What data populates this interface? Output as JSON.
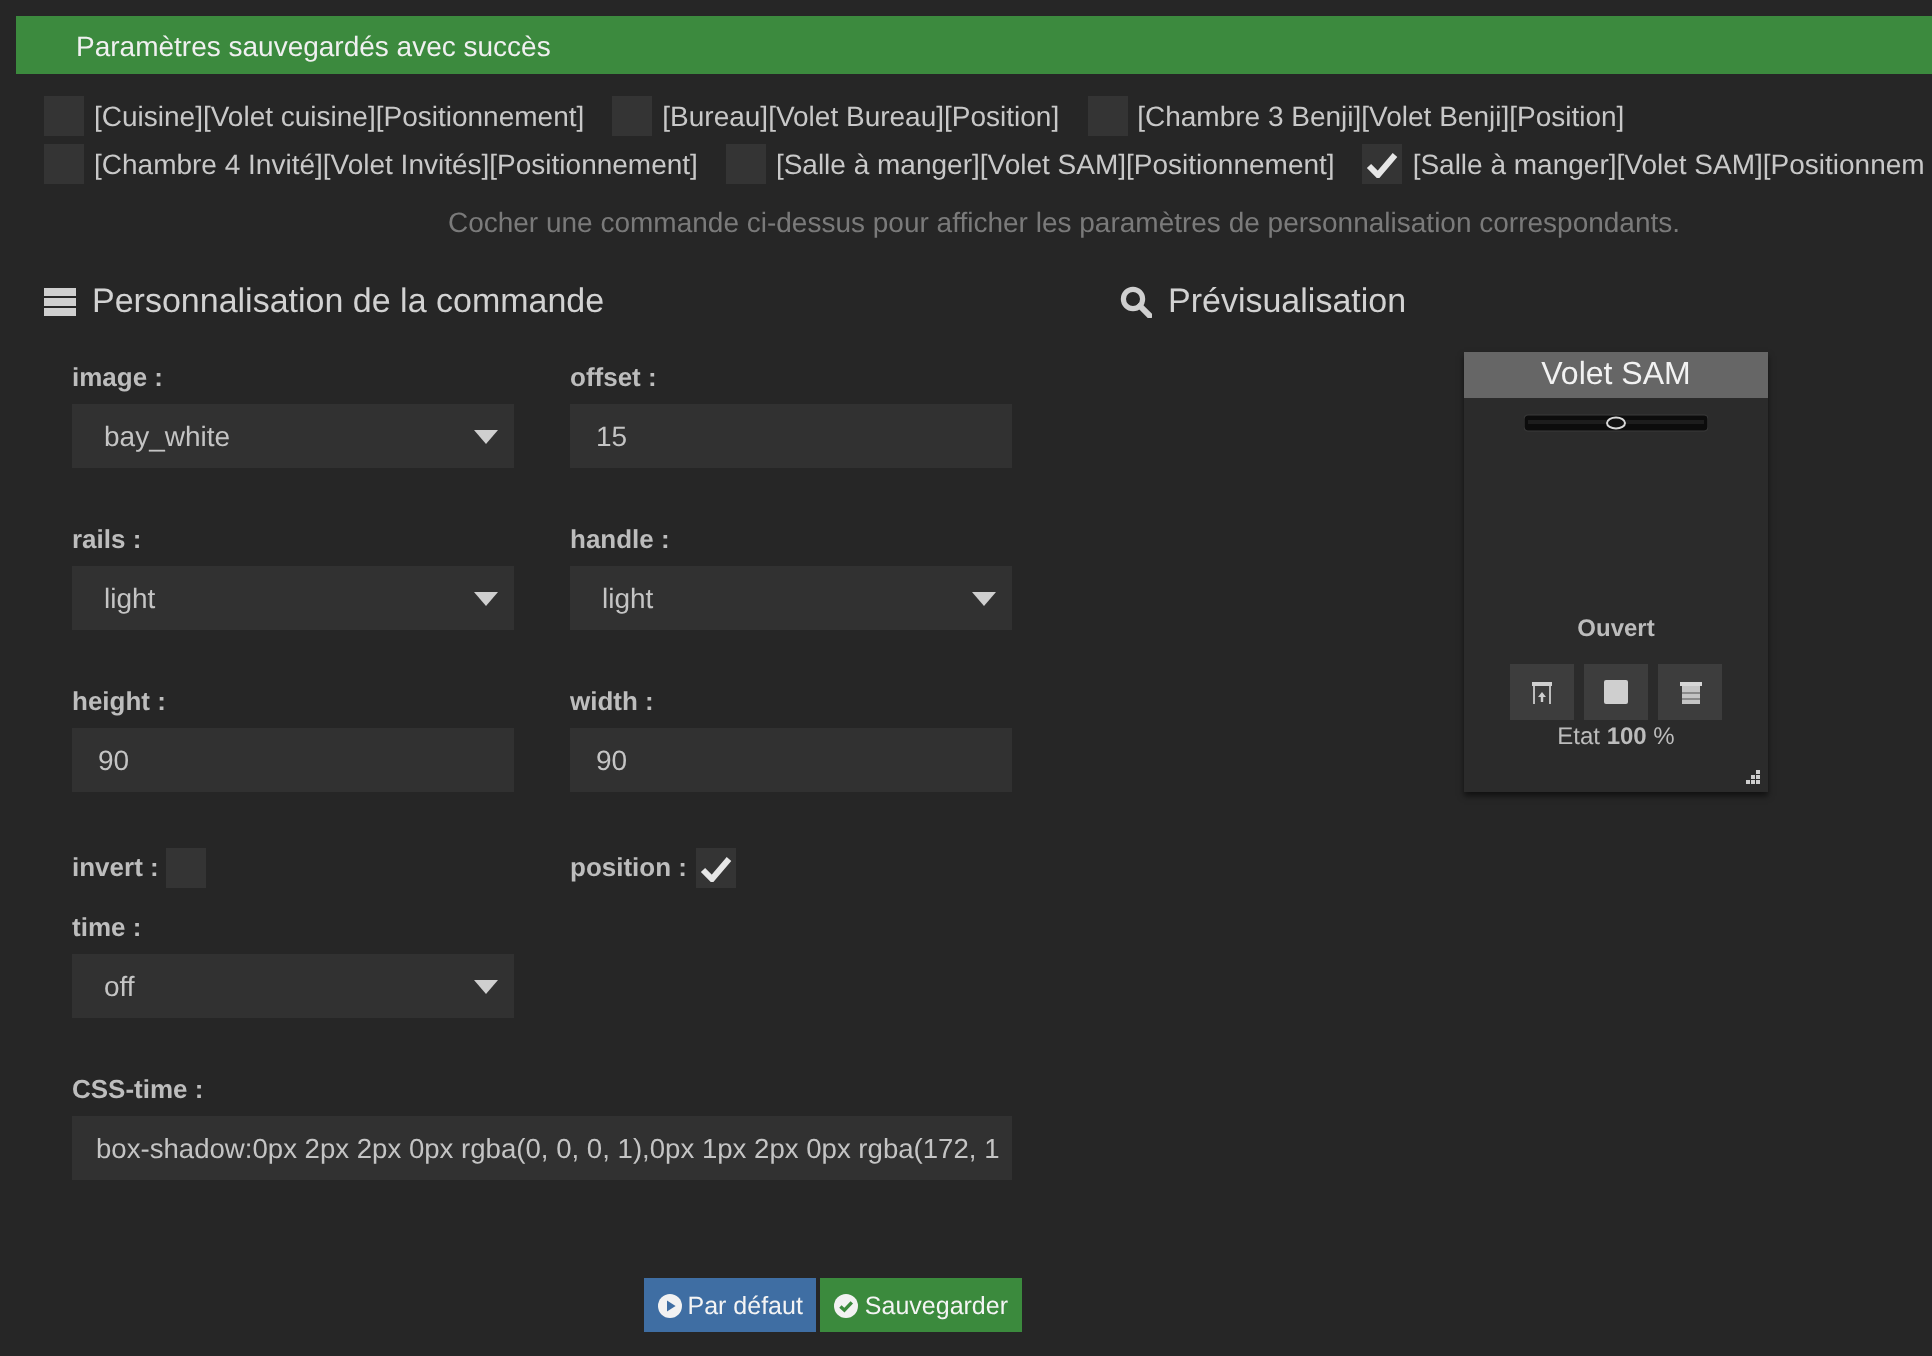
{
  "banner": {
    "text": "Paramètres sauvegardés avec succès"
  },
  "commands": [
    {
      "label": "[Cuisine][Volet cuisine][Positionnement]",
      "checked": false
    },
    {
      "label": "[Bureau][Volet Bureau][Position]",
      "checked": false
    },
    {
      "label": "[Chambre 3 Benji][Volet Benji][Position]",
      "checked": false
    },
    {
      "label": "[Chambre 4 Invité][Volet Invités][Positionnement]",
      "checked": false
    },
    {
      "label": "[Salle à manger][Volet SAM][Positionnement]",
      "checked": false
    },
    {
      "label": "[Salle à manger][Volet SAM][Positionnem",
      "checked": true
    }
  ],
  "hint": "Cocher une commande ci-dessus pour afficher les paramètres de personnalisation correspondants.",
  "customization": {
    "title": "Personnalisation de la commande",
    "fields": [
      {
        "kind": "select",
        "label": "image :",
        "value": "bay_white"
      },
      {
        "kind": "input",
        "label": "offset :",
        "value": "15"
      },
      {
        "kind": "select",
        "label": "rails :",
        "value": "light"
      },
      {
        "kind": "select",
        "label": "handle :",
        "value": "light"
      },
      {
        "kind": "input",
        "label": "height :",
        "value": "90"
      },
      {
        "kind": "input",
        "label": "width :",
        "value": "90"
      },
      {
        "kind": "checkbox",
        "label": "invert :",
        "checked": false
      },
      {
        "kind": "checkbox",
        "label": "position :",
        "checked": true
      },
      {
        "kind": "select",
        "label": "time :",
        "value": "off"
      },
      {
        "kind": "long_input",
        "label": "CSS-time :",
        "value": "box-shadow:0px 2px 2px 0px rgba(0, 0, 0, 1),0px 1px 2px 0px rgba(172, 1"
      }
    ]
  },
  "buttons": [
    {
      "kind": "default",
      "label": "Par défaut"
    },
    {
      "kind": "save",
      "label": "Sauvegarder"
    }
  ],
  "preview": {
    "title": "Prévisualisation",
    "widget": {
      "title": "Volet SAM",
      "state": "Ouvert",
      "controls": [
        {
          "kind": "open"
        },
        {
          "kind": "stop"
        },
        {
          "kind": "close"
        }
      ],
      "status": "Etat **100** %"
    }
  }
}
